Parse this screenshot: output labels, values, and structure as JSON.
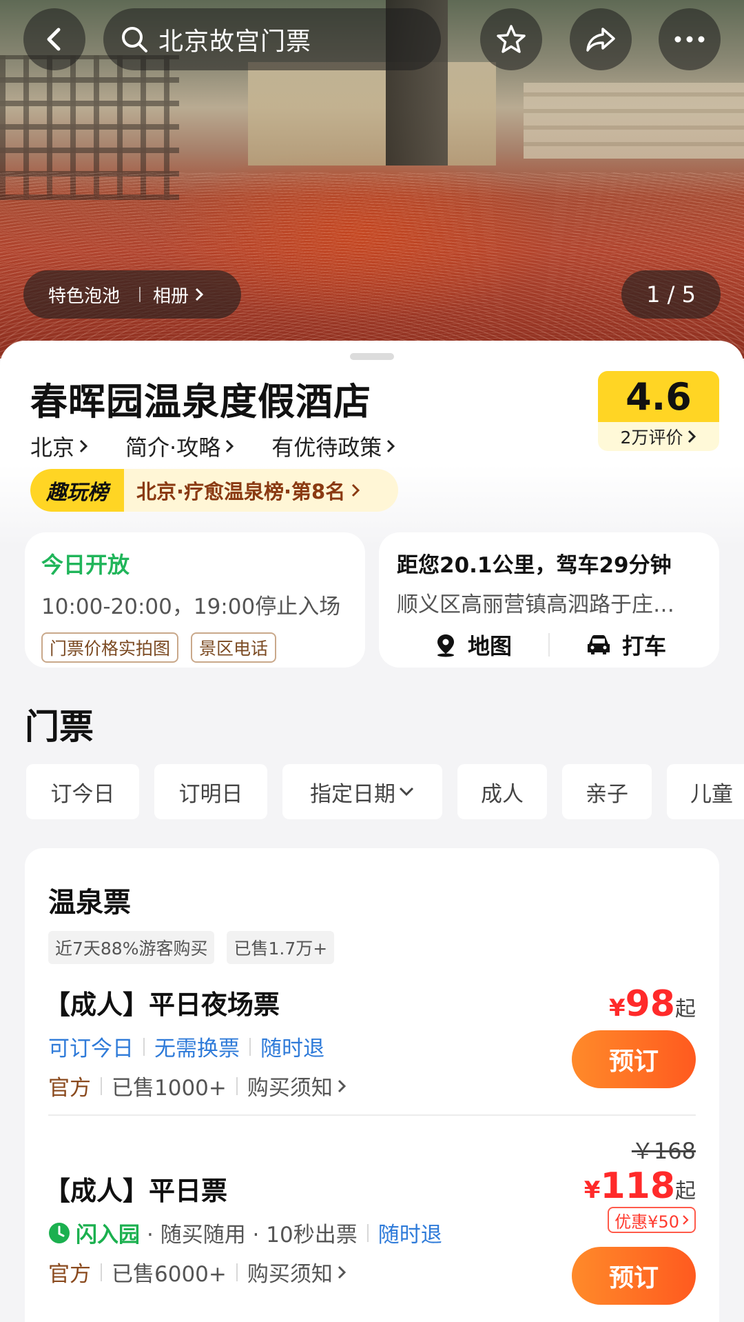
{
  "search": {
    "query": "北京故宫门票"
  },
  "gallery": {
    "album_tag": "特色泡池",
    "album_link": "相册",
    "counter": "1 / 5"
  },
  "hotel": {
    "name": "春晖园温泉度假酒店",
    "links": [
      "北京",
      "简介·攻略",
      "有优待政策"
    ],
    "rating": "4.6",
    "reviews": "2万评价",
    "rank_tag": "趣玩榜",
    "rank_text": "北京·疗愈温泉榜·第8名"
  },
  "open_info": {
    "status": "今日开放",
    "hours": "10:00-20:00，19:00停止入场",
    "chips": [
      "门票价格实拍图",
      "景区电话"
    ]
  },
  "location": {
    "distance": "距您20.1公里，驾车29分钟",
    "address": "顺义区高丽营镇高泗路于庄…",
    "map_label": "地图",
    "taxi_label": "打车"
  },
  "tickets_section": {
    "title": "门票",
    "filters": [
      "订今日",
      "订明日",
      "指定日期",
      "成人",
      "亲子",
      "儿童"
    ]
  },
  "panel": {
    "title": "温泉票",
    "tags": [
      "近7天88%游客购买",
      "已售1.7万+"
    ],
    "items": [
      {
        "name": "【成人】平日夜场票",
        "features": [
          "可订今日",
          "无需换票",
          "随时退"
        ],
        "official": "官方",
        "sold": "已售1000+",
        "notice": "购买须知",
        "currency": "¥",
        "price": "98",
        "suffix": "起",
        "book": "预订"
      },
      {
        "name": "【成人】平日票",
        "flash": "闪入园",
        "feature_text": "· 随买随用 · 10秒出票",
        "refund": "随时退",
        "official": "官方",
        "sold": "已售6000+",
        "notice": "购买须知",
        "original_price": "￥168",
        "currency": "¥",
        "price": "118",
        "suffix": "起",
        "discount": "优惠¥50",
        "book": "预订"
      }
    ]
  },
  "colors": {
    "accent_orange": "#ff6a1f",
    "price_red": "#ff2a2a",
    "open_green": "#20b55a",
    "link_blue": "#2f7bd9",
    "rating_yellow": "#ffd524"
  }
}
